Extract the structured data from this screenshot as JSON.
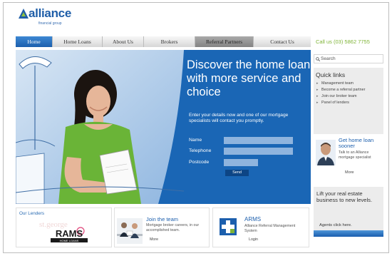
{
  "brand": {
    "name": "alliance",
    "tagline": "financial group",
    "color": "#1f5ea8"
  },
  "nav": {
    "items": [
      {
        "label": "Home",
        "active": true
      },
      {
        "label": "Home Loans"
      },
      {
        "label": "About Us"
      },
      {
        "label": "Brokers"
      },
      {
        "label": "Referral Partners"
      },
      {
        "label": "Contact Us"
      }
    ]
  },
  "header": {
    "phone": "Call us (03) 5862 7755"
  },
  "hero": {
    "headline": "Discover the home loan with more service and choice",
    "intro": "Enter your details now and one of our mortgage specialists will contact you promptly.",
    "fields": [
      {
        "label": "Name",
        "value": ""
      },
      {
        "label": "Telephone",
        "value": ""
      },
      {
        "label": "Postcode",
        "value": ""
      }
    ],
    "send_label": "Send"
  },
  "sidebar": {
    "search_placeholder": "Search",
    "quick_links_title": "Quick links",
    "quick_links": [
      "Management team",
      "Become a referral partner",
      "Join our broker team",
      "Panel of lenders"
    ],
    "contact": {
      "title": "Get home loan sooner",
      "text": "Talk to an Alliance mortgage specialist",
      "more": "More"
    },
    "real_estate": {
      "text": "Lift your real estate business to new levels.",
      "link": "Agents click here."
    }
  },
  "bottom": {
    "lenders": {
      "title": "Our Lenders",
      "logo_text": "RAMS",
      "logo_sub": "HOME LOANS",
      "faint_text": "st.george"
    },
    "team": {
      "title": "Join the team",
      "text": "Mortgage broker careers, in our accomplished team.",
      "more": "More"
    },
    "arms": {
      "title": "ARMS",
      "text": "Alliance Referral Management System",
      "login": "Login"
    }
  },
  "colors": {
    "hero_blue": "#1a66b5",
    "nav_active": "#2a72c2",
    "phone_green": "#7fb437"
  }
}
